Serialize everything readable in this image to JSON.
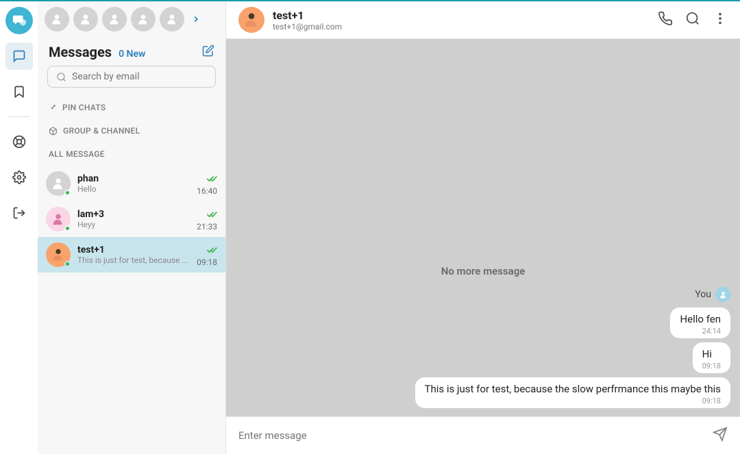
{
  "rail": {
    "items": [
      "messages",
      "bookmarks",
      "support",
      "settings",
      "logout"
    ]
  },
  "stories": {
    "count": 5
  },
  "panel": {
    "title": "Messages",
    "new_count": "0",
    "new_label": "New",
    "search_placeholder": "Search by email",
    "section_pin": "PIN CHATS",
    "section_group": "GROUP & CHANNEL",
    "section_all": "ALL MESSAGE"
  },
  "chats": [
    {
      "name": "phan",
      "preview": "Hello",
      "time": "16:40",
      "read": true,
      "avatar": "grey"
    },
    {
      "name": "lam+3",
      "preview": "Heyy",
      "time": "21:33",
      "read": true,
      "avatar": "pink"
    },
    {
      "name": "test+1",
      "preview": "This is just for test, because ...",
      "time": "09:18",
      "read": true,
      "avatar": "orange",
      "active": true
    }
  ],
  "header": {
    "name": "test+1",
    "email": "test+1@gmail.com"
  },
  "thread": {
    "no_more": "No more message",
    "sender": "You",
    "messages": [
      {
        "text": "Hello fen",
        "time": "24:14"
      },
      {
        "text": "Hi",
        "time": "09:18"
      },
      {
        "text": "This is just for test, because the slow perfrmance this maybe this",
        "time": "09:18"
      }
    ]
  },
  "composer": {
    "placeholder": "Enter message"
  }
}
